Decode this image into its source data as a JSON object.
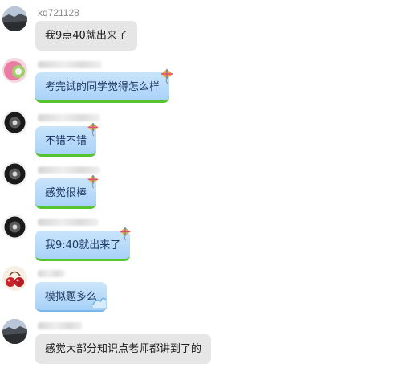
{
  "chat": {
    "messages": [
      {
        "sender": "xq721128",
        "text": "我9点40就出来了"
      },
      {
        "sender": "",
        "text": "考完试的同学觉得怎么样"
      },
      {
        "sender": "",
        "text": "不错不错"
      },
      {
        "sender": "",
        "text": "感觉很棒"
      },
      {
        "sender": "",
        "text": "我9:40就出来了"
      },
      {
        "sender": "",
        "text": "模拟题多么"
      },
      {
        "sender": "",
        "text": "感觉大部分知识点老师都讲到了的"
      }
    ]
  },
  "colors": {
    "bubble_gray": "#e6e6e6",
    "bubble_blue": "#a9d2f8",
    "bubble_green_trim": "#55c52f",
    "sender_name": "#8a8a8a"
  },
  "icons": {
    "kite": "kite-sticker-icon",
    "wave": "wave-sticker-icon"
  }
}
